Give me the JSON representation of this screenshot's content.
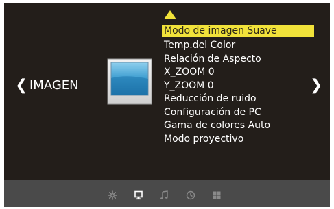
{
  "section": {
    "title": "IMAGEN",
    "left_arrow": "❮",
    "right_arrow": "❯"
  },
  "menu": {
    "items": [
      {
        "label": "Modo de imagen Suave",
        "selected": true
      },
      {
        "label": "Temp.del Color",
        "selected": false
      },
      {
        "label": "Relación de Aspecto",
        "selected": false
      },
      {
        "label": "X_ZOOM 0",
        "selected": false
      },
      {
        "label": "Y_ZOOM 0",
        "selected": false
      },
      {
        "label": "Reducción de ruido",
        "selected": false
      },
      {
        "label": "Configuración de PC",
        "selected": false
      },
      {
        "label": "Gama de colores Auto",
        "selected": false
      },
      {
        "label": "Modo proyectivo",
        "selected": false
      }
    ]
  },
  "tabs": [
    {
      "icon": "settings-icon",
      "active": false
    },
    {
      "icon": "picture-icon",
      "active": true
    },
    {
      "icon": "music-note-icon",
      "active": false
    },
    {
      "icon": "clock-icon",
      "active": false
    },
    {
      "icon": "grid-icon",
      "active": false
    }
  ],
  "colors": {
    "panel_bg": "#231e1a",
    "bar_bg": "#4a4a4a",
    "highlight": "#f1e23a",
    "text": "#ffffff"
  }
}
